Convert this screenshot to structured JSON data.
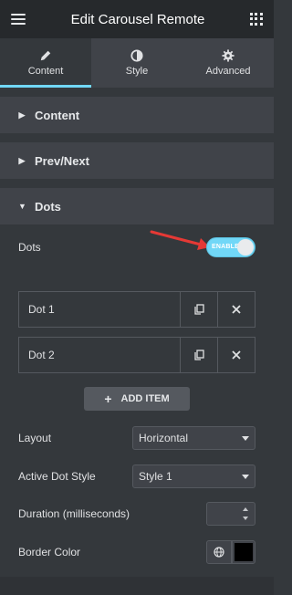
{
  "topbar": {
    "title": "Edit Carousel Remote",
    "menu_icon": "hamburger-icon",
    "apps_icon": "grid-icon"
  },
  "tabs": [
    {
      "label": "Content",
      "icon": "pencil-icon",
      "active": true
    },
    {
      "label": "Style",
      "icon": "half-circle-icon",
      "active": false
    },
    {
      "label": "Advanced",
      "icon": "gear-icon",
      "active": false
    }
  ],
  "sections": {
    "content": {
      "label": "Content",
      "expanded": false
    },
    "prevnext": {
      "label": "Prev/Next",
      "expanded": false
    },
    "dots": {
      "label": "Dots",
      "expanded": true
    }
  },
  "dots_panel": {
    "dots_label": "Dots",
    "toggle_text": "ENABLE",
    "toggle_on": true,
    "items": [
      {
        "name": "Dot 1"
      },
      {
        "name": "Dot 2"
      }
    ],
    "add_item_label": "ADD ITEM",
    "layout_label": "Layout",
    "layout_value": "Horizontal",
    "active_dot_style_label": "Active Dot Style",
    "active_dot_style_value": "Style 1",
    "duration_label": "Duration (milliseconds)",
    "duration_value": "",
    "border_color_label": "Border Color",
    "border_color_value": "#000000"
  },
  "colors": {
    "accent": "#71d7f7",
    "annotation_arrow": "#e53935"
  }
}
